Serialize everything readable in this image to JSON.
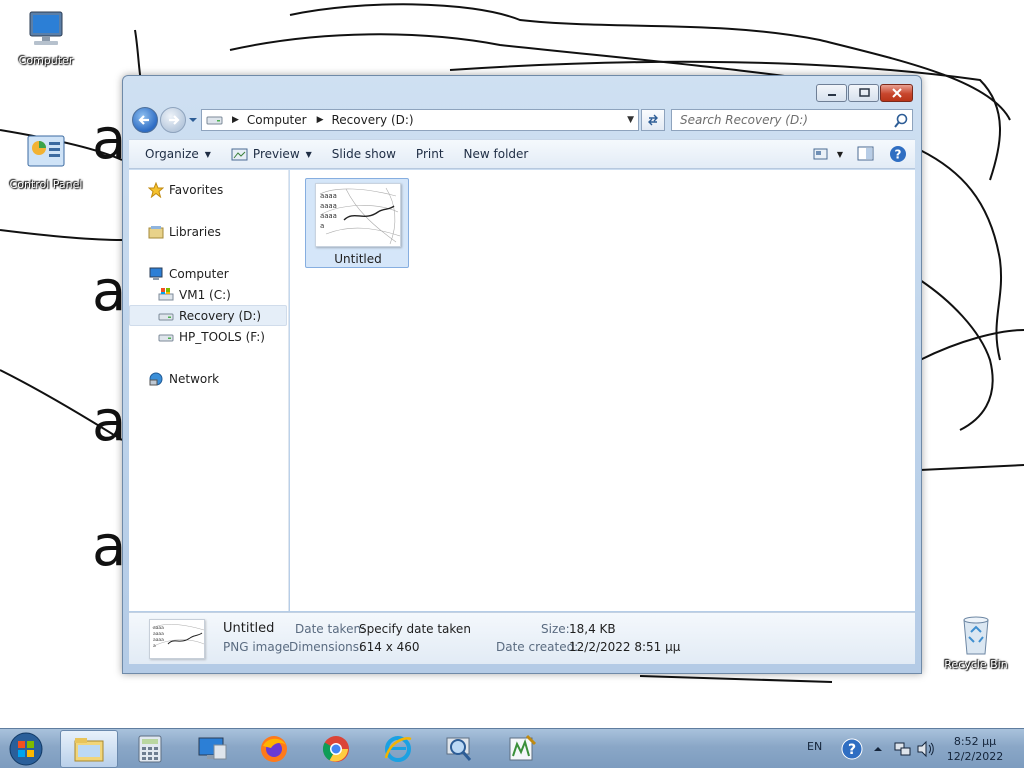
{
  "desktop": {
    "icons": [
      {
        "label": "Computer"
      },
      {
        "label": "Control Panel"
      },
      {
        "label": "Recycle Bin"
      }
    ]
  },
  "window": {
    "buttons": {
      "minimize": "minimize-icon",
      "maximize": "maximize-icon",
      "close": "close-icon"
    }
  },
  "address": {
    "segments": [
      "Computer",
      "Recovery (D:)"
    ]
  },
  "search": {
    "placeholder": "Search Recovery (D:)"
  },
  "toolbar": {
    "organize": "Organize",
    "preview": "Preview",
    "slideshow": "Slide show",
    "print": "Print",
    "new_folder": "New folder"
  },
  "nav": {
    "favorites": "Favorites",
    "libraries": "Libraries",
    "computer": "Computer",
    "drives": [
      "VM1 (C:)",
      "Recovery (D:)",
      "HP_TOOLS (F:)"
    ],
    "network": "Network",
    "selected": "Recovery (D:)"
  },
  "files": [
    {
      "name": "Untitled",
      "thumb_text": [
        "aaaa",
        "aaaa",
        "aaaa",
        "a"
      ]
    }
  ],
  "details": {
    "name": "Untitled",
    "type": "PNG image",
    "date_taken_label": "Date taken:",
    "date_taken_value": "Specify date taken",
    "dimensions_label": "Dimensions:",
    "dimensions_value": "614 x 460",
    "size_label": "Size:",
    "size_value": "18,4 KB",
    "date_created_label": "Date created:",
    "date_created_value": "12/2/2022 8:51 μμ"
  },
  "taskbar": {
    "apps": [
      "windows-explorer",
      "calculator",
      "remote-desktop",
      "firefox",
      "chrome",
      "internet-explorer",
      "magnifier",
      "paint-editor"
    ],
    "tray": {
      "language": "EN",
      "time": "8:52 μμ",
      "date": "12/2/2022"
    }
  },
  "colors": {
    "selection": "#d5e6f9",
    "window_frame": "#bcd2ea",
    "taskbar": "#8aa7c7"
  }
}
